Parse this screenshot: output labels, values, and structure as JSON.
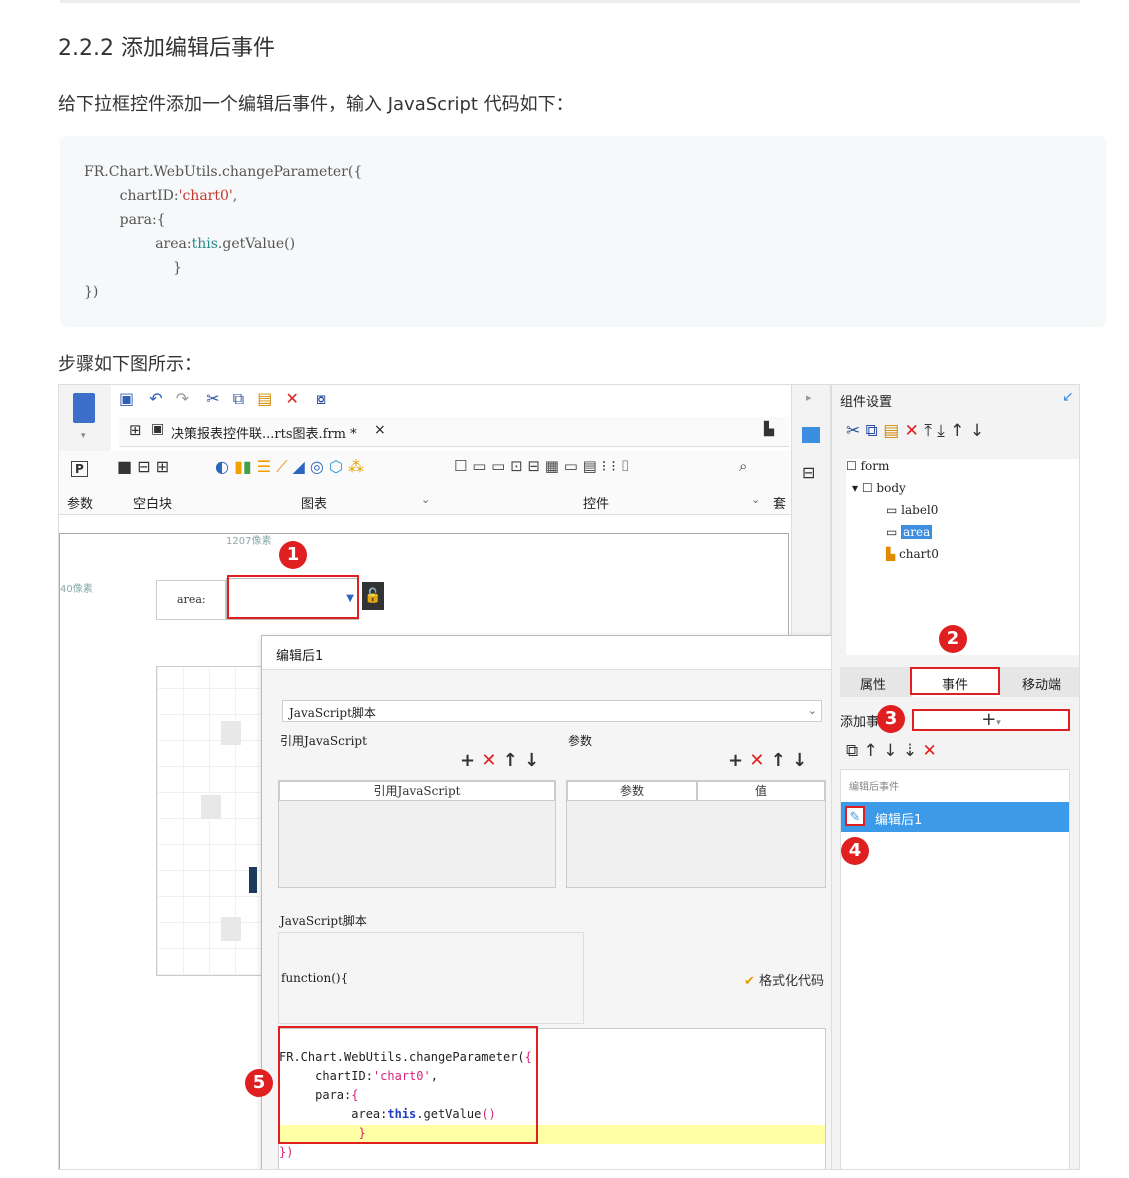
{
  "heading": "2.2.2 添加编辑后事件",
  "intro": "给下拉框控件添加一个编辑后事件，输入 JavaScript 代码如下：",
  "code": {
    "line1": "FR.Chart.WebUtils.changeParameter({",
    "line2a": "        chartID:",
    "line2b": "'chart0'",
    "line2c": ",",
    "line3": "        para:{",
    "line4a": "                area:",
    "line4b": "this",
    "line4c": ".getValue()",
    "line5": "                    }",
    "line6": "})"
  },
  "steps_label": "步骤如下图所示：",
  "toolbar": {
    "tab_title": "决策报表控件联...rts图表.frm *",
    "tab_close": "×",
    "groups": [
      "参数",
      "空白块",
      "图表",
      "控件",
      "套"
    ],
    "p_label": "P"
  },
  "canvas": {
    "ruler_top": "1207像素",
    "ruler_left": "40像素",
    "area_label": "area:"
  },
  "dialog": {
    "title": "编辑后1",
    "type_select": "JavaScript脚本",
    "ref_js_section": "引用JavaScript",
    "params_section": "参数",
    "ref_js_col": "引用JavaScript",
    "param_col": "参数",
    "value_col": "值",
    "script_section": "JavaScript脚本",
    "function_sig": "function(){",
    "format_code": "格式化代码",
    "code_l1a": "FR.Chart.WebUtils.changeParameter(",
    "code_l1b": "{",
    "code_l2a": "     chartID:",
    "code_l2b": "'chart0'",
    "code_l2c": ",",
    "code_l3a": "     para:",
    "code_l3b": "{",
    "code_l4a": "          area:",
    "code_l4b": "this",
    "code_l4c": ".getValue",
    "code_l4d": "()",
    "code_l5": "           }",
    "code_l6": "})"
  },
  "right_panel": {
    "title": "组件设置",
    "tree": [
      "form",
      "body",
      "label0",
      "area",
      "chart0"
    ],
    "tabs": [
      "属性",
      "事件",
      "移动端"
    ],
    "add_event_label": "添加事",
    "add_event_btn": "+",
    "event_group": "编辑后事件",
    "event_item": "编辑后1"
  },
  "badges": [
    "1",
    "2",
    "3",
    "4",
    "5"
  ],
  "colors": {
    "accent": "#3c8fe0",
    "red": "#e02020",
    "selected": "#3c9ae8",
    "highlight": "#ffffa6"
  }
}
